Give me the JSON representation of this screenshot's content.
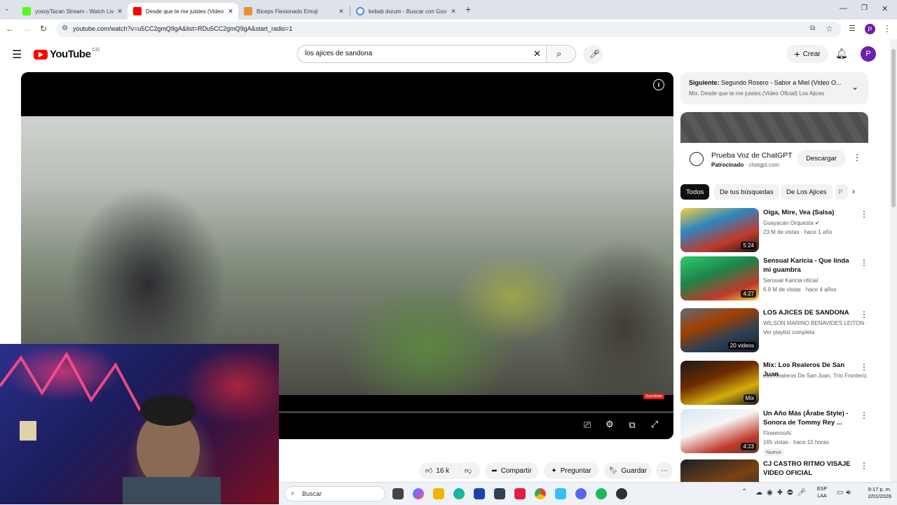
{
  "browser": {
    "tabs": [
      {
        "title": "yosoyTacan Stream - Watch Liv",
        "favicon_color": "#53fc18"
      },
      {
        "title": "Desde que te me juistes (Video",
        "favicon_color": "#ff0000"
      },
      {
        "title": "Biceps Flexionado Emoji",
        "favicon_color": "#e8912d"
      },
      {
        "title": "kebab durum - Buscar con Goo",
        "favicon_color": "#4285f4"
      }
    ],
    "url": "youtube.com/watch?v=u5CC2gmQ9gA&list=RDu5CC2gmQ9gA&start_radio=1",
    "profile_initial": "P"
  },
  "youtube": {
    "logo_text": "YouTube",
    "country": "CO",
    "search_value": "los ajices de sandona",
    "create_label": "Crear",
    "avatar_initial": "P"
  },
  "player": {
    "subscribe_badge": "Suscríbete"
  },
  "actions": {
    "likes": "16 k",
    "share": "Compartir",
    "ask": "Preguntar",
    "save": "Guardar"
  },
  "sidebar": {
    "next_label": "Siguiente:",
    "next_title": "Segundo Rosero - Sabor a Miel (Video O...",
    "mix_label": "Mix: Desde que te me juistes (Video Oficial) Los Ajices",
    "ad": {
      "title": "Prueba Voz de ChatGPT",
      "sponsored": "Patrocinado",
      "domain": "chatgpt.com",
      "cta": "Descargar"
    },
    "chips": [
      "Todos",
      "De tus búsquedas",
      "De Los Ajices",
      "P"
    ],
    "items": [
      {
        "title": "Oiga, Mire, Vea (Salsa)",
        "channel": "Guayacán Orquesta",
        "meta": "23 M de vistas · hace 1 año",
        "duration": "5:24"
      },
      {
        "title": "Sensual Karicia - Que linda mi guambra",
        "channel": "Sensual Karicia oficial",
        "meta": "6.9 M de vistas · hace 4 años",
        "duration": "4:27"
      },
      {
        "title": "LOS AJICES DE SANDONA",
        "channel": "WILSON MARINO BENAVIDES LEITON · P...",
        "meta": "Ver playlist completa",
        "duration": "20 videos"
      },
      {
        "title": "Mix: Los Realeros De San Juan",
        "channel": "Los Realeros De San Juan, Trío Fronteriz...",
        "meta": "",
        "duration": "Mix"
      },
      {
        "title": "Un Año Más (Árabe Style) - Sonora de Tommy Rey ...",
        "channel": "FlowersoAI",
        "meta": "165 vistas · hace 10 horas",
        "badge": "Nuevo",
        "duration": "4:23"
      },
      {
        "title": "CJ CASTRO RITMO VISAJE VIDEO OFICIAL",
        "channel": "",
        "meta": "",
        "duration": ""
      }
    ]
  },
  "taskbar": {
    "search_placeholder": "Buscar",
    "lang": "ESP",
    "lang2": "LAA",
    "time": "9:17 p. m.",
    "date": "2/01/2026"
  }
}
